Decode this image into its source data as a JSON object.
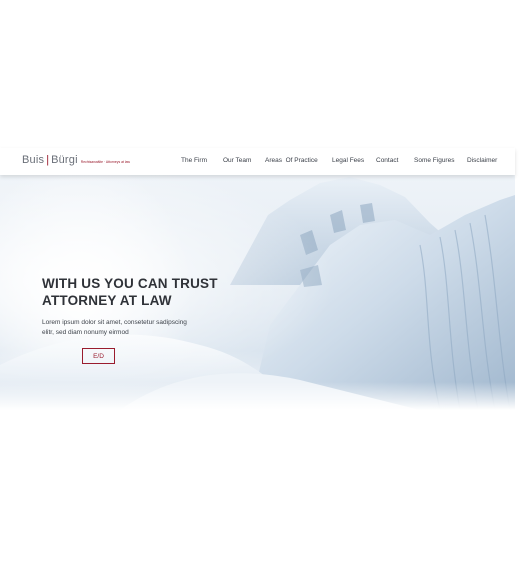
{
  "header": {
    "logo": {
      "word_left": "Buis",
      "separator": "|",
      "word_right": "Bürgi",
      "tagline": "Rechtsanwälte · Attorneys at law"
    },
    "nav": [
      {
        "label": "The Firm"
      },
      {
        "label": "Our Team"
      },
      {
        "label": "Areas  Of Practice"
      },
      {
        "label": "Legal Fees"
      },
      {
        "label": "Contact"
      },
      {
        "label": "Some Figures"
      },
      {
        "label": "Disclaimer"
      }
    ]
  },
  "hero": {
    "title": "WITH US YOU CAN TRUST ATTORNEY AT LAW",
    "text": "Lorem ipsum dolor sit amet, consetetur sadipscing elitr, sed diam nonumy eirmod",
    "button_label": "E/D",
    "background": "snowy-glacier-photo"
  },
  "colors": {
    "accent": "#9a1c2e",
    "text_dark": "#2f3238",
    "nav_text": "#3a3f48"
  }
}
